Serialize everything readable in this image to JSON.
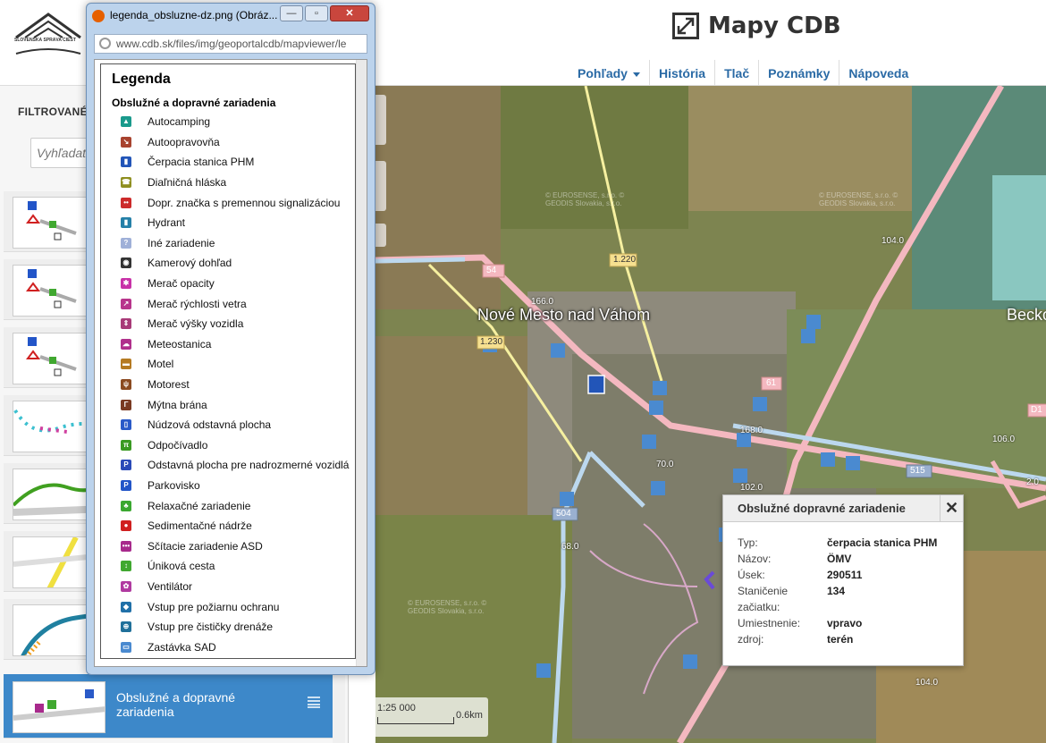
{
  "header": {
    "app_title": "Mapy CDB",
    "nav": [
      {
        "label": "Pohľady",
        "dropdown": true
      },
      {
        "label": "História"
      },
      {
        "label": "Tlač"
      },
      {
        "label": "Poznámky"
      },
      {
        "label": "Nápoveda"
      }
    ],
    "logo_text": "SLOVENSKÁ SPRÁVA CIEST"
  },
  "sidebar": {
    "heading": "FILTROVANÉ I",
    "search_placeholder": "Vyhľadať",
    "active_layer_label": "Obslužné a dopravné zariadenia"
  },
  "map": {
    "place_labels": [
      "Nové Mesto nad Váhom",
      "Becko"
    ],
    "road_labels": [
      "54",
      "1.220",
      "1.230",
      "61",
      "504",
      "515",
      "D1"
    ],
    "chainage_labels": [
      "166.0",
      "104.0",
      "168.0",
      "70.0",
      "102.0",
      "68.0",
      "106.0",
      "2.0",
      "104.0"
    ],
    "watermark": "© EUROSENSE, s.r.o. © GEODIS Slovakia, s.r.o.",
    "scale_ratio": "1:25 000",
    "scale_length": "0.6km"
  },
  "popup": {
    "title": "Obslužné dopravné zariadenie",
    "close": "✕",
    "rows": [
      {
        "k": "Typ:",
        "v": "čerpacia stanica PHM"
      },
      {
        "k": "Názov:",
        "v": "ÖMV"
      },
      {
        "k": "Úsek:",
        "v": "290511"
      },
      {
        "k": "Staničenie začiatku:",
        "v": "134"
      },
      {
        "k": "Umiestnenie:",
        "v": "vpravo"
      },
      {
        "k": "zdroj:",
        "v": "terén"
      }
    ]
  },
  "window": {
    "title": "legenda_obsluzne-dz.png (Obráz...",
    "url": "www.cdb.sk/files/img/geoportalcdb/mapviewer/le",
    "btn_min": "—",
    "btn_max": "▫",
    "btn_close": "✕",
    "legend_title": "Legenda",
    "legend_section": "Obslužné a dopravné zariadenia",
    "items": [
      {
        "label": "Autocamping",
        "color": "#1a9a8c",
        "glyph": "▲"
      },
      {
        "label": "Autoopravovňa",
        "color": "#a8432f",
        "glyph": "↘"
      },
      {
        "label": "Čerpacia stanica PHM",
        "color": "#2255b8",
        "glyph": "▮"
      },
      {
        "label": "Diaľničná hláska",
        "color": "#8f8f20",
        "glyph": "☎"
      },
      {
        "label": "Dopr. značka s premennou signalizáciou",
        "color": "#cc2a2a",
        "glyph": "••"
      },
      {
        "label": "Hydrant",
        "color": "#2580a8",
        "glyph": "▮"
      },
      {
        "label": "Iné zariadenie",
        "color": "#9fb0d8",
        "glyph": "?"
      },
      {
        "label": "Kamerový dohľad",
        "color": "#333333",
        "glyph": "◉"
      },
      {
        "label": "Merač opacity",
        "color": "#c832a8",
        "glyph": "✱"
      },
      {
        "label": "Merač rýchlosti vetra",
        "color": "#b8348c",
        "glyph": "↗"
      },
      {
        "label": "Merač výšky vozidla",
        "color": "#a83a78",
        "glyph": "⇕"
      },
      {
        "label": "Meteostanica",
        "color": "#b0308c",
        "glyph": "☁"
      },
      {
        "label": "Motel",
        "color": "#b57a22",
        "glyph": "▬"
      },
      {
        "label": "Motorest",
        "color": "#8b4a20",
        "glyph": "ψ"
      },
      {
        "label": "Mýtna brána",
        "color": "#7a3a22",
        "glyph": "Γ"
      },
      {
        "label": "Núdzová odstavná plocha",
        "color": "#2a5ac8",
        "glyph": "▯"
      },
      {
        "label": "Odpočívadlo",
        "color": "#3a9a22",
        "glyph": "π"
      },
      {
        "label": "Odstavná plocha pre nadrozmerné vozidlá",
        "color": "#2a4ab8",
        "glyph": "P"
      },
      {
        "label": "Parkovisko",
        "color": "#2255c8",
        "glyph": "P"
      },
      {
        "label": "Relaxačné zariadenie",
        "color": "#3aa830",
        "glyph": "♣"
      },
      {
        "label": "Sedimentačné nádrže",
        "color": "#d02020",
        "glyph": "●"
      },
      {
        "label": "Sčítacie zariadenie ASD",
        "color": "#a82a8c",
        "glyph": "•••"
      },
      {
        "label": "Úniková cesta",
        "color": "#40a830",
        "glyph": "↕"
      },
      {
        "label": "Ventilátor",
        "color": "#b03aa0",
        "glyph": "✿"
      },
      {
        "label": "Vstup pre požiarnu ochranu",
        "color": "#2070a8",
        "glyph": "◆"
      },
      {
        "label": "Vstup pre čističky drenáže",
        "color": "#20709a",
        "glyph": "⊕"
      },
      {
        "label": "Zastávka SAD",
        "color": "#4a8ad0",
        "glyph": "▭"
      }
    ]
  }
}
